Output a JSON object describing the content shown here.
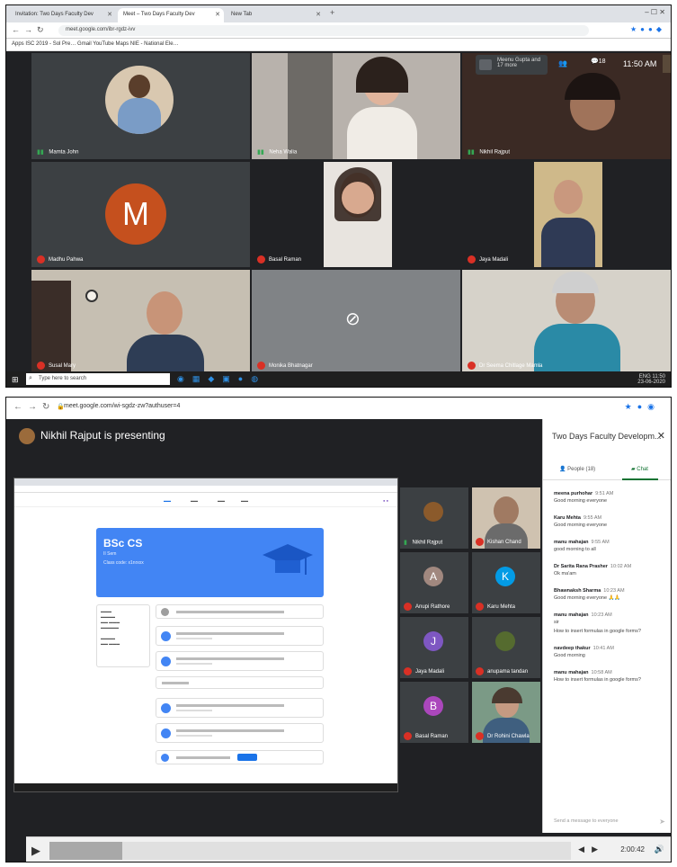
{
  "top": {
    "tabs": [
      {
        "label": "Invitation: Two Days Faculty Dev"
      },
      {
        "label": "Meet – Two Days Faculty Dev"
      },
      {
        "label": "New Tab"
      }
    ],
    "url": "meet.google.com/ibr-rgdz-ivv",
    "bookmarks": "Apps   ISC 2019 - Sol Pre…   Gmail   YouTube   Maps   NIE - National Ele…",
    "chip_label": "Meenu Gupta and 17 more",
    "people_count": "18",
    "clock": "11:50 AM",
    "tiles": [
      {
        "name": "Mamta John",
        "mic": "on"
      },
      {
        "name": "Neha Walia",
        "mic": "on"
      },
      {
        "name": "Nikhil Rajput",
        "mic": "on"
      },
      {
        "name": "Madhu Pahwa",
        "mic": "off",
        "initial": "M"
      },
      {
        "name": "Basal Raman",
        "mic": "off"
      },
      {
        "name": "Jaya Madali",
        "mic": "off"
      },
      {
        "name": "Susal Mary",
        "mic": "off"
      },
      {
        "name": "Monika Bhatnagar",
        "mic": "off"
      },
      {
        "name": "Dr Seema Chitlage Mamla",
        "mic": "off"
      }
    ],
    "taskbar": {
      "search_placeholder": "Type here to search",
      "tray_time": "11:50",
      "tray_date": "23-06-2020",
      "tray_lang": "ENG"
    }
  },
  "bottom": {
    "url": "meet.google.com/wi-sgdz-zw?authuser=4",
    "presenting_text": "Nikhil Rajput is presenting",
    "classroom": {
      "class_name": "BSc CS",
      "section": "II Sem",
      "class_code_label": "Class code: x1nrxxx"
    },
    "participants": [
      {
        "name": "Nikhil Rajput",
        "initial": "",
        "color": "#8b5a2b"
      },
      {
        "name": "Kishan Chand",
        "initial": "",
        "color": "#6b6b6b"
      },
      {
        "name": "Anupi Rathore",
        "initial": "A",
        "color": "#a1887f"
      },
      {
        "name": "Karu Mehta",
        "initial": "K",
        "color": "#039be5"
      },
      {
        "name": "Jaya Madali",
        "initial": "J",
        "color": "#7e57c2"
      },
      {
        "name": "anupama tandan",
        "initial": "",
        "color": "#556b2f"
      },
      {
        "name": "Basal Raman",
        "initial": "B",
        "color": "#ab47bc"
      },
      {
        "name": "Dr Rohini Chawla",
        "initial": "",
        "color": "#5a7d6b"
      }
    ],
    "side": {
      "title": "Two Days Faculty Developm...",
      "tab_people": "People (18)",
      "tab_chat": "Chat",
      "messages": [
        {
          "who": "meena purhohar",
          "time": "9:51 AM",
          "text": "Good morning everyone"
        },
        {
          "who": "Karu Mehta",
          "time": "9:55 AM",
          "text": "Good morning everyone"
        },
        {
          "who": "manu mahajan",
          "time": "9:55 AM",
          "text": "good morning to all"
        },
        {
          "who": "Dr Sarita Rana Prasher",
          "time": "10:02 AM",
          "text": "Ok ma'am"
        },
        {
          "who": "Bhawnaksh Sharma",
          "time": "10:23 AM",
          "text": "Good morning everyone 🙏🙏"
        },
        {
          "who": "manu mahajan",
          "time": "10:23 AM",
          "text": "sir"
        },
        {
          "who": "",
          "time": "",
          "text": "How to insert formulas in google forms?"
        },
        {
          "who": "navdeep thakur",
          "time": "10:41 AM",
          "text": "Good morning"
        },
        {
          "who": "manu mahajan",
          "time": "10:58 AM",
          "text": "How to insert formulas in google forms?"
        }
      ],
      "compose_placeholder": "Send a message to everyone"
    },
    "player": {
      "time": "2:00:42",
      "progress": 0.14
    }
  }
}
